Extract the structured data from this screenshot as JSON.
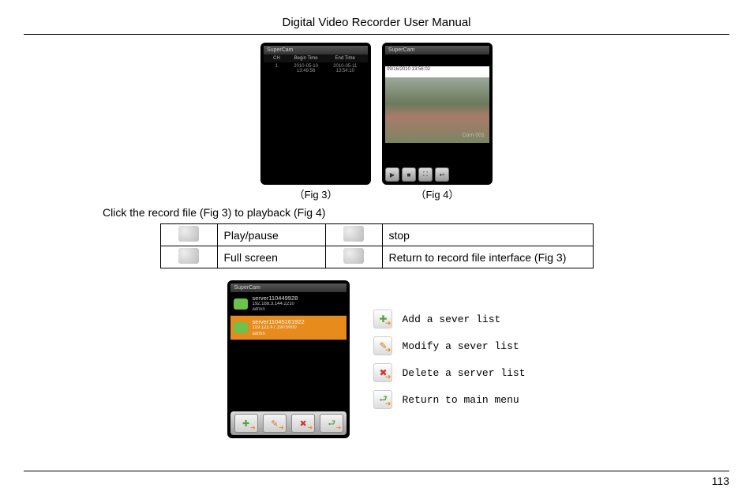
{
  "header": {
    "title": "Digital Video Recorder User Manual"
  },
  "figures": {
    "fig3": {
      "app_title": "SuperCam",
      "columns": {
        "ch": "CH",
        "begin": "Begin Time",
        "end": "End Time"
      },
      "row": {
        "ch": "1",
        "begin": "2010-05-10 13:49:56",
        "end": "2010-05-11 13:54:10"
      },
      "caption": "（Fig 3）"
    },
    "fig4": {
      "app_title": "SuperCam",
      "timestamp": "09/16/2010  13:58:02",
      "cam_label": "Cam 001",
      "caption": "（Fig 4）"
    }
  },
  "instruction": "Click the record file (Fig 3) to playback (Fig 4)",
  "table": {
    "r1c1": "Play/pause",
    "r1c2": "stop",
    "r2c1": "Full screen",
    "r2c2": "Return to record file interface (Fig 3)"
  },
  "server_list": {
    "app_title": "SuperCam",
    "items": [
      {
        "name": "server110449928",
        "ip": "192.168.3.144:2210",
        "admin": "admin"
      },
      {
        "name": "server11045161922",
        "ip": "119.122.47.190:9000",
        "admin": "admin"
      }
    ]
  },
  "legend": {
    "add": "Add a sever list",
    "modify": "Modify a sever list",
    "delete": "Delete a server list",
    "return": "Return to main menu"
  },
  "page_number": "113"
}
